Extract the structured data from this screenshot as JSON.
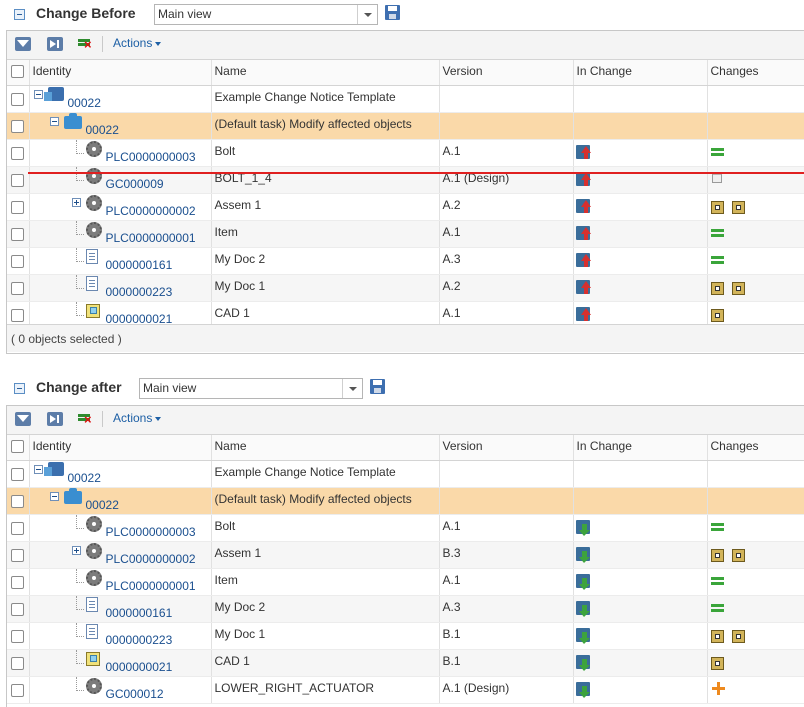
{
  "before": {
    "title": "Change Before",
    "view": "Main view",
    "actions_label": "Actions",
    "columns": [
      "Identity",
      "Name",
      "Version",
      "In Change",
      "Changes"
    ],
    "rows": [
      {
        "id": "00022",
        "name": "Example Change Notice Template",
        "version": "",
        "icon": "change-notice-icon",
        "in_change": "",
        "changes": []
      },
      {
        "id": "00022",
        "name": "(Default task) Modify affected objects",
        "version": "",
        "icon": "task-folder-icon",
        "in_change": "",
        "changes": []
      },
      {
        "id": "PLC0000000003",
        "name": "Bolt",
        "version": "A.1",
        "icon": "part-gear-icon",
        "in_change": "change-out-icon",
        "changes": [
          "unchanged-icon"
        ]
      },
      {
        "id": "GC000009",
        "name": "BOLT_1_4",
        "version": "A.1 (Design)",
        "icon": "part-gear-icon",
        "in_change": "change-out-icon",
        "changes": [
          "removed-icon"
        ]
      },
      {
        "id": "PLC0000000002",
        "name": "Assem 1",
        "version": "A.2",
        "icon": "part-gear-icon",
        "in_change": "change-out-icon",
        "changes": [
          "modified-icon",
          "modified-compare-icon"
        ]
      },
      {
        "id": "PLC0000000001",
        "name": "Item",
        "version": "A.1",
        "icon": "part-gear-icon",
        "in_change": "change-out-icon",
        "changes": [
          "unchanged-icon"
        ]
      },
      {
        "id": "0000000161",
        "name": "My Doc 2",
        "version": "A.3",
        "icon": "document-icon",
        "in_change": "change-out-icon",
        "changes": [
          "unchanged-icon"
        ]
      },
      {
        "id": "0000000223",
        "name": "My Doc 1",
        "version": "A.2",
        "icon": "document-icon",
        "in_change": "change-out-icon",
        "changes": [
          "modified-icon",
          "modified-compare-icon"
        ]
      },
      {
        "id": "0000000021",
        "name": "CAD 1",
        "version": "A.1",
        "icon": "cad-icon",
        "in_change": "change-out-icon",
        "changes": [
          "modified-icon"
        ]
      }
    ],
    "status": "( 0 objects selected )"
  },
  "after": {
    "title": "Change after",
    "view": "Main view",
    "actions_label": "Actions",
    "columns": [
      "Identity",
      "Name",
      "Version",
      "In Change",
      "Changes"
    ],
    "rows": [
      {
        "id": "00022",
        "name": "Example Change Notice Template",
        "version": "",
        "icon": "change-notice-icon",
        "in_change": "",
        "changes": []
      },
      {
        "id": "00022",
        "name": "(Default task) Modify affected objects",
        "version": "",
        "icon": "task-folder-icon",
        "in_change": "",
        "changes": []
      },
      {
        "id": "PLC0000000003",
        "name": "Bolt",
        "version": "A.1",
        "icon": "part-gear-icon",
        "in_change": "change-in-icon",
        "changes": [
          "unchanged-icon"
        ]
      },
      {
        "id": "PLC0000000002",
        "name": "Assem 1",
        "version": "B.3",
        "icon": "part-gear-icon",
        "in_change": "change-in-icon",
        "changes": [
          "modified-icon",
          "modified-compare-icon"
        ]
      },
      {
        "id": "PLC0000000001",
        "name": "Item",
        "version": "A.1",
        "icon": "part-gear-icon",
        "in_change": "change-in-icon",
        "changes": [
          "unchanged-icon"
        ]
      },
      {
        "id": "0000000161",
        "name": "My Doc 2",
        "version": "A.3",
        "icon": "document-icon",
        "in_change": "change-in-icon",
        "changes": [
          "unchanged-icon"
        ]
      },
      {
        "id": "0000000223",
        "name": "My Doc 1",
        "version": "B.1",
        "icon": "document-icon",
        "in_change": "change-in-icon",
        "changes": [
          "modified-icon",
          "modified-compare-icon"
        ]
      },
      {
        "id": "0000000021",
        "name": "CAD 1",
        "version": "B.1",
        "icon": "cad-icon",
        "in_change": "change-in-icon",
        "changes": [
          "modified-icon"
        ]
      },
      {
        "id": "GC000012",
        "name": "LOWER_RIGHT_ACTUATOR",
        "version": "A.1 (Design)",
        "icon": "part-gear-icon",
        "in_change": "change-in-icon",
        "changes": [
          "added-icon"
        ]
      }
    ]
  },
  "colors": {
    "task_row": "#fad9a9",
    "removed_line": "#e02020",
    "link": "#1a4f8f",
    "unchanged": "#3aa53a",
    "added": "#ee8a1e"
  }
}
